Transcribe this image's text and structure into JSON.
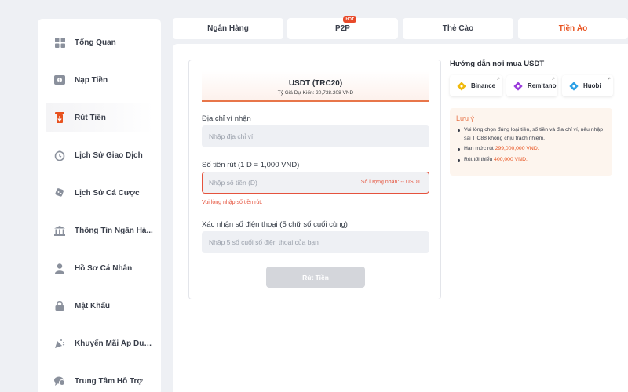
{
  "sidebar": {
    "items": [
      {
        "label": "Tổng Quan",
        "icon": "dashboard-icon"
      },
      {
        "label": "Nạp Tiền",
        "icon": "deposit-icon"
      },
      {
        "label": "Rút Tiền",
        "icon": "withdraw-icon",
        "active": true
      },
      {
        "label": "Lịch Sử Giao Dịch",
        "icon": "transaction-history-icon"
      },
      {
        "label": "Lịch Sử Cá Cược",
        "icon": "bet-history-icon"
      },
      {
        "label": "Thông Tin Ngân Hà...",
        "icon": "bank-icon"
      },
      {
        "label": "Hồ Sơ Cá Nhân",
        "icon": "profile-icon"
      },
      {
        "label": "Mật Khẩu",
        "icon": "lock-icon"
      },
      {
        "label": "Khuyến Mãi Áp Dụng",
        "icon": "promotion-icon"
      },
      {
        "label": "Trung Tâm Hỗ Trợ",
        "icon": "support-icon"
      }
    ]
  },
  "tabs": [
    {
      "label": "Ngân Hàng"
    },
    {
      "label": "P2P",
      "badge": "HOT"
    },
    {
      "label": "Thẻ Cào"
    },
    {
      "label": "Tiền Ảo",
      "active": true
    }
  ],
  "form": {
    "coin_title": "USDT (TRC20)",
    "rate": "Tỷ Giá Dự Kiến: 20,738.208 VND",
    "wallet_label": "Địa chỉ ví nhận",
    "wallet_placeholder": "Nhập địa chỉ ví",
    "amount_label": "Số tiền rút (1 D = 1,000 VND)",
    "amount_placeholder": "Nhập số tiền (D)",
    "amount_received": "Số lượng nhận: -- USDT",
    "amount_error": "Vui lòng nhập số tiền rút.",
    "phone_label": "Xác nhận số điện thoại (5 chữ số cuối cùng)",
    "phone_placeholder": "Nhập 5 số cuối số điện thoại của bạn",
    "submit_label": "Rút Tiền"
  },
  "guide": {
    "title": "Hướng dẫn nơi mua USDT",
    "exchanges": [
      {
        "label": "Binance",
        "icon": "binance-icon",
        "color": "#f0b90b"
      },
      {
        "label": "Remitano",
        "icon": "remitano-icon",
        "color": "#9b3ddb"
      },
      {
        "label": "Huobi",
        "icon": "huobi-icon",
        "color": "#2ea1e6"
      }
    ],
    "corner_mark": "↗"
  },
  "note": {
    "title": "Lưu ý",
    "item1": "Vui lòng chọn đúng loại tiền, số tiền và địa chỉ ví, nếu nhập sai TIC88 không chịu trách nhiệm.",
    "item2_prefix": "Hạn mức rút ",
    "item2_value": "299,000,000 VND.",
    "item3_prefix": "Rút tối thiểu ",
    "item3_value": "400,000 VND."
  },
  "colors": {
    "accent": "#e8521f",
    "error": "#e5533d",
    "background": "#eef0f4"
  }
}
